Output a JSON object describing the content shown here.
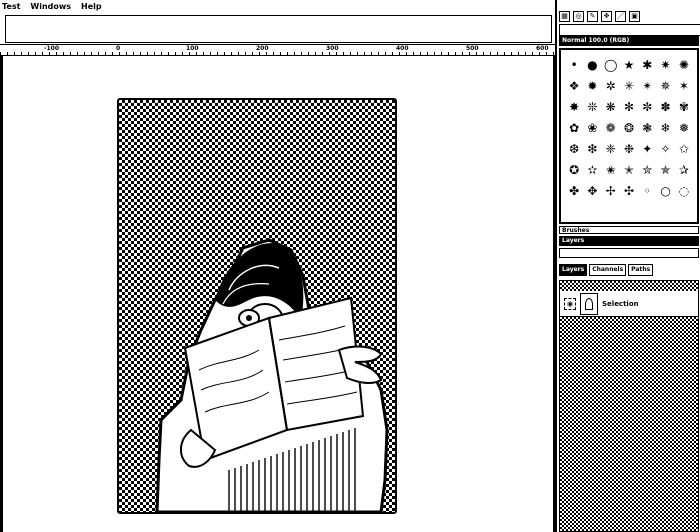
{
  "menu": {
    "items": [
      "Test",
      "Windows",
      "Help"
    ]
  },
  "ruler": {
    "labels": [
      "-100",
      "0",
      "100",
      "200",
      "300",
      "400",
      "500",
      "600"
    ]
  },
  "dock": {
    "title_bar": "Normal 100.0 (RGB)",
    "tool_icons": [
      "rect-select-icon",
      "ellipse-select-icon",
      "lasso-icon",
      "move-icon",
      "pencil-icon",
      "crop-icon"
    ],
    "brushes": [
      "•",
      "●",
      "◯",
      "★",
      "✱",
      "✷",
      "✺",
      "❖",
      "✹",
      "✲",
      "✳",
      "✴",
      "✵",
      "✶",
      "✸",
      "❊",
      "❋",
      "✻",
      "✼",
      "✽",
      "✾",
      "✿",
      "❀",
      "❁",
      "❂",
      "❃",
      "❄",
      "❅",
      "❆",
      "❇",
      "❈",
      "❉",
      "✦",
      "✧",
      "✩",
      "✪",
      "✫",
      "✬",
      "✭",
      "✮",
      "✯",
      "✰",
      "✤",
      "✥",
      "✢",
      "✣",
      "◦",
      "○",
      "◌"
    ],
    "panel_label": "Brushes",
    "panel_bar": "Layers",
    "tabs": [
      "Layers",
      "Channels",
      "Paths"
    ],
    "layer": {
      "name": "Selection",
      "visibility": "eye-icon"
    }
  }
}
